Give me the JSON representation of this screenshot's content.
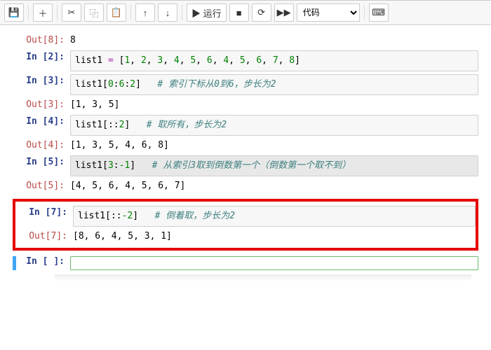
{
  "toolbar": {
    "save_icon": "💾",
    "add_icon": "＋",
    "cut_icon": "✂",
    "copy_icon": "⿻",
    "paste_icon": "📋",
    "up_icon": "↑",
    "down_icon": "↓",
    "run_label": "▶ 运行",
    "stop_icon": "■",
    "restart_icon": "⟳",
    "ff_icon": "▶▶",
    "celltype": "代码",
    "cmd_icon": "⌨"
  },
  "cells": [
    {
      "kind": "out",
      "n": "8",
      "text": "8"
    },
    {
      "kind": "in",
      "n": "2",
      "code": {
        "type": "assign",
        "lhs": "list1",
        "list": [
          1,
          2,
          3,
          4,
          5,
          6,
          4,
          5,
          6,
          7,
          8
        ]
      }
    },
    {
      "kind": "in",
      "n": "3",
      "code": {
        "type": "slice",
        "target": "list1",
        "slice": "0:6:2",
        "comment": "# 索引下标从0到6，步长为2"
      }
    },
    {
      "kind": "out",
      "n": "3",
      "text": "[1, 3, 5]"
    },
    {
      "kind": "in",
      "n": "4",
      "code": {
        "type": "slice",
        "target": "list1",
        "slice": "::2",
        "comment": "# 取所有，步长为2"
      }
    },
    {
      "kind": "out",
      "n": "4",
      "text": "[1, 3, 5, 4, 6, 8]"
    },
    {
      "kind": "in",
      "n": "5",
      "code": {
        "type": "slice",
        "target": "list1",
        "slice": "3:-1",
        "comment": "# 从索引3取到倒数第一个（倒数第一个取不到）"
      },
      "selected": true
    },
    {
      "kind": "out",
      "n": "5",
      "text": "[4, 5, 6, 4, 5, 6, 7]"
    },
    {
      "kind": "hl-start"
    },
    {
      "kind": "in",
      "n": "7",
      "code": {
        "type": "slice",
        "target": "list1",
        "slice": "::-2",
        "comment": "# 倒着取，步长为2"
      }
    },
    {
      "kind": "out",
      "n": "7",
      "text": "[8, 6, 4, 5, 3, 1]"
    },
    {
      "kind": "hl-end"
    },
    {
      "kind": "in",
      "n": " ",
      "code": {
        "type": "empty"
      },
      "active": true
    }
  ]
}
